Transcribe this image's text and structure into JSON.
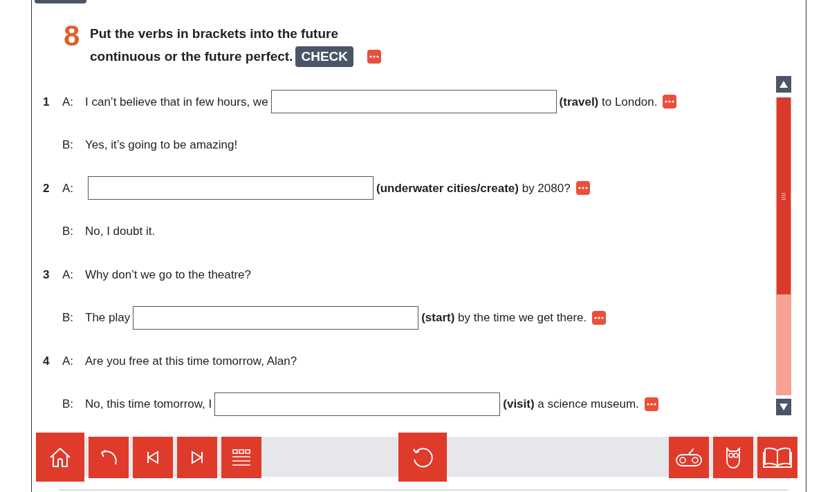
{
  "exercise": {
    "number": "8",
    "instruction_line_1": "Put the verbs in brackets into the future",
    "instruction_line_2": "continuous or the future perfect.",
    "check_button": "CHECK"
  },
  "items": [
    {
      "number": "1",
      "lines": [
        {
          "speaker": "A:",
          "parts": [
            {
              "kind": "text",
              "text": "I can’t believe that in few hours, we"
            },
            {
              "kind": "blank"
            },
            {
              "kind": "text",
              "text": "**(travel)** to London."
            },
            {
              "kind": "answer"
            }
          ]
        },
        {
          "speaker": "B:",
          "parts": [
            {
              "kind": "text",
              "text": "Yes, it’s going to be amazing!"
            }
          ]
        }
      ]
    },
    {
      "number": "2",
      "lines": [
        {
          "speaker": "A:",
          "parts": [
            {
              "kind": "blank"
            },
            {
              "kind": "text",
              "text": "**(underwater cities/create)** by 2080?"
            },
            {
              "kind": "answer"
            }
          ]
        },
        {
          "speaker": "B:",
          "parts": [
            {
              "kind": "text",
              "text": "No, I doubt it."
            }
          ]
        }
      ]
    },
    {
      "number": "3",
      "lines": [
        {
          "speaker": "A:",
          "parts": [
            {
              "kind": "text",
              "text": "Why don’t we go to the theatre?"
            }
          ]
        },
        {
          "speaker": "B:",
          "parts": [
            {
              "kind": "text",
              "text": "The play"
            },
            {
              "kind": "blank"
            },
            {
              "kind": "text",
              "text": "**(start)** by the time we get there."
            },
            {
              "kind": "answer"
            }
          ]
        }
      ]
    },
    {
      "number": "4",
      "lines": [
        {
          "speaker": "A:",
          "parts": [
            {
              "kind": "text",
              "text": "Are you free at this time tomorrow, Alan?"
            }
          ]
        },
        {
          "speaker": "B:",
          "parts": [
            {
              "kind": "text",
              "text": "No, this time tomorrow, I"
            },
            {
              "kind": "blank"
            },
            {
              "kind": "text",
              "text": "**(visit)** a science museum."
            },
            {
              "kind": "answer"
            }
          ]
        }
      ]
    }
  ]
}
